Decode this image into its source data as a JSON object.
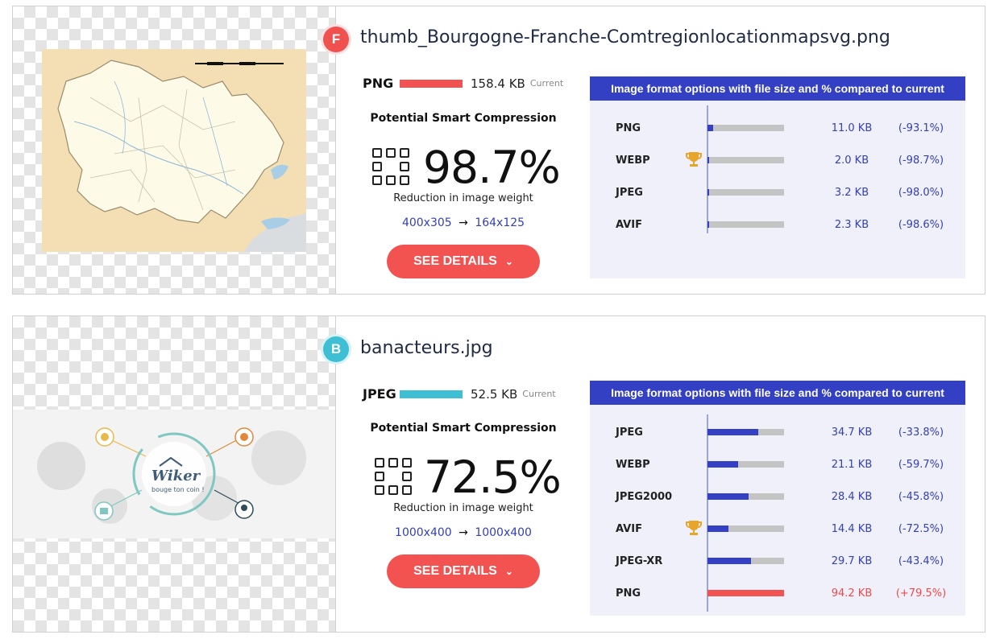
{
  "colors": {
    "grade_f": "#f0504e",
    "grade_b": "#3fbfd4",
    "accent_blue": "#3340c4",
    "accent_red": "#f25250",
    "trophy": "#e9a52a"
  },
  "cards": [
    {
      "grade": "F",
      "file_name": "thumb_Bourgogne-Franche-Comtregionlocationmapsvg.png",
      "current_format": "PNG",
      "current_size": "158.4 KB",
      "current_label": "Current",
      "psc_title": "Potential Smart Compression",
      "compression_pct": "98.7%",
      "reduction_label": "Reduction in image weight",
      "dims_from": "400x305",
      "dims_arrow": "→",
      "dims_to": "164x125",
      "details_label": "SEE DETAILS",
      "options_title": "Image format options with file size and % compared to current",
      "options": [
        {
          "format": "PNG",
          "size": "11.0 KB",
          "pct": "(-93.1%)",
          "fraction": 0.07,
          "best": false,
          "worse": false
        },
        {
          "format": "WEBP",
          "size": "2.0 KB",
          "pct": "(-98.7%)",
          "fraction": 0.013,
          "best": true,
          "worse": false
        },
        {
          "format": "JPEG",
          "size": "3.2 KB",
          "pct": "(-98.0%)",
          "fraction": 0.02,
          "best": false,
          "worse": false
        },
        {
          "format": "AVIF",
          "size": "2.3 KB",
          "pct": "(-98.6%)",
          "fraction": 0.014,
          "best": false,
          "worse": false
        }
      ]
    },
    {
      "grade": "B",
      "file_name": "banacteurs.jpg",
      "current_format": "JPEG",
      "current_size": "52.5 KB",
      "current_label": "Current",
      "psc_title": "Potential Smart Compression",
      "compression_pct": "72.5%",
      "reduction_label": "Reduction in image weight",
      "dims_from": "1000x400",
      "dims_arrow": "→",
      "dims_to": "1000x400",
      "details_label": "SEE DETAILS",
      "image_caption": "bouge ton coin !",
      "image_logo": "Wiker",
      "options_title": "Image format options with file size and % compared to current",
      "options": [
        {
          "format": "JPEG",
          "size": "34.7 KB",
          "pct": "(-33.8%)",
          "fraction": 0.662,
          "best": false,
          "worse": false
        },
        {
          "format": "WEBP",
          "size": "21.1 KB",
          "pct": "(-59.7%)",
          "fraction": 0.403,
          "best": false,
          "worse": false
        },
        {
          "format": "JPEG2000",
          "size": "28.4 KB",
          "pct": "(-45.8%)",
          "fraction": 0.542,
          "best": false,
          "worse": false
        },
        {
          "format": "AVIF",
          "size": "14.4 KB",
          "pct": "(-72.5%)",
          "fraction": 0.275,
          "best": true,
          "worse": false
        },
        {
          "format": "JPEG-XR",
          "size": "29.7 KB",
          "pct": "(-43.4%)",
          "fraction": 0.566,
          "best": false,
          "worse": false
        },
        {
          "format": "PNG",
          "size": "94.2 KB",
          "pct": "(+79.5%)",
          "fraction": 1.0,
          "best": false,
          "worse": true
        }
      ]
    }
  ]
}
